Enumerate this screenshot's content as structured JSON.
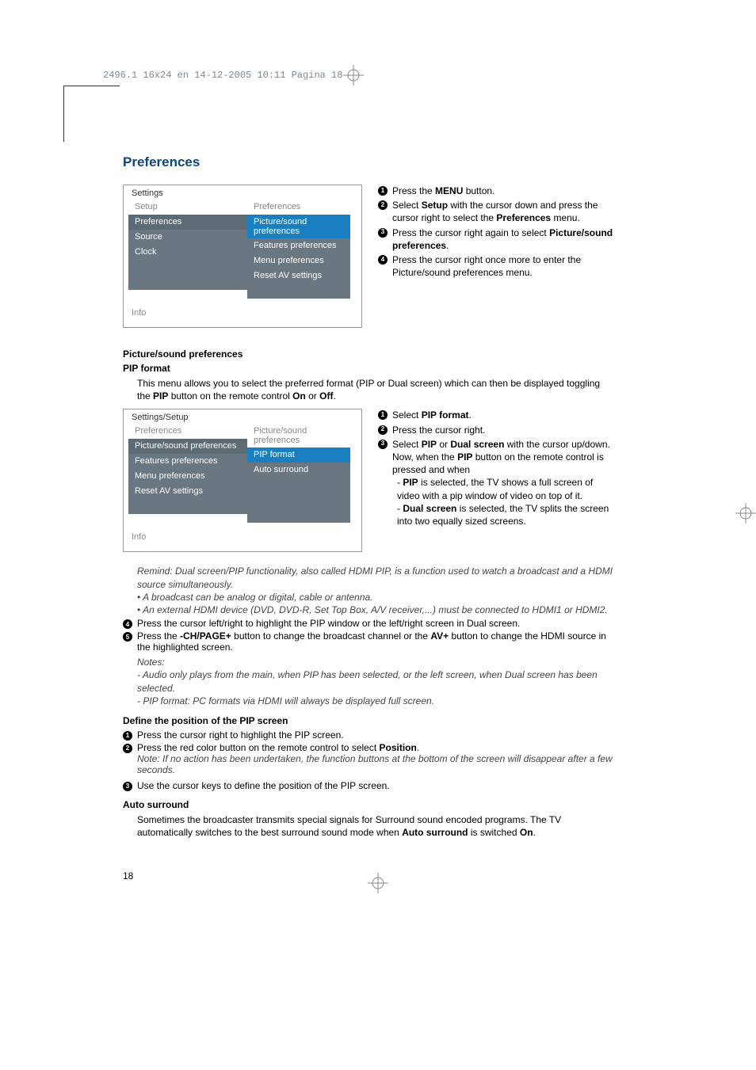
{
  "header_line": "2496.1 16x24 en  14-12-2005  10:11  Pagina 18",
  "title": "Preferences",
  "menu1": {
    "title": "Settings",
    "colA": [
      "Setup",
      "Preferences",
      "Source",
      "Clock",
      "",
      ""
    ],
    "colB_header": "Preferences",
    "colB": [
      "Picture/sound preferences",
      "Features preferences",
      "Menu preferences",
      "Reset AV settings",
      ""
    ],
    "info": "Info"
  },
  "steps1": {
    "s1": "Press the ",
    "s1b": "MENU",
    "s1c": " button.",
    "s2a": "Select ",
    "s2b": "Setup",
    "s2c": " with the cursor down and press the cursor right to select the ",
    "s2d": "Preferences",
    "s2e": " menu.",
    "s3a": "Press the cursor right again to select ",
    "s3b": "Picture/sound preferences",
    "s3c": ".",
    "s4": "Press the cursor right once more to enter the Picture/sound preferences menu."
  },
  "pic_sound_h": "Picture/sound preferences",
  "pip_format_h": "PIP format",
  "pip_intro_a": "This menu allows you to select the preferred format (PIP or Dual screen) which can then be displayed toggling the ",
  "pip_intro_b": "PIP",
  "pip_intro_c": " button on the remote control ",
  "pip_intro_d": "On",
  "pip_intro_e": " or ",
  "pip_intro_f": "Off",
  "pip_intro_g": ".",
  "menu2": {
    "title": "Settings/Setup",
    "colA_header": "Preferences",
    "colA": [
      "Picture/sound preferences",
      "Features preferences",
      "Menu preferences",
      "Reset AV settings",
      ""
    ],
    "colB_header": "Picture/sound preferences",
    "colB": [
      "PIP format",
      "Auto surround",
      "",
      "",
      ""
    ],
    "info": "Info"
  },
  "steps2": {
    "s1a": "Select ",
    "s1b": "PIP format",
    "s1c": ".",
    "s2": "Press the cursor right.",
    "s3a": "Select ",
    "s3b": "PIP",
    "s3c": " or ",
    "s3d": "Dual screen",
    "s3e": " with the cursor up/down. Now, when the ",
    "s3f": "PIP",
    "s3g": " button on the remote control is pressed and when",
    "sub1a": "- ",
    "sub1b": "PIP",
    "sub1c": " is selected, the TV shows a full screen of video with a pip window of video on top of it.",
    "sub2a": "- ",
    "sub2b": "Dual screen",
    "sub2c": " is selected, the TV splits the screen into two equally sized screens."
  },
  "remind": "Remind: Dual screen/PIP functionality, also called HDMI PIP, is a function used to watch a broadcast and a HDMI source simultaneously.",
  "remind_b1": "• A broadcast can be analog or digital, cable or antenna.",
  "remind_b2": "• An external HDMI device (DVD, DVD-R, Set Top Box, A/V receiver,...) must be  connected to HDMI1 or HDMI2.",
  "s4": "Press the cursor left/right to highlight the PIP window or the left/right screen in Dual screen.",
  "s5a": "Press the ",
  "s5b": "-CH/PAGE+",
  "s5c": " button to change the broadcast channel or the ",
  "s5d": "AV+",
  "s5e": " button to change the HDMI source in the highlighted screen.",
  "notes_h": "Notes:",
  "note1": "- Audio only plays from the main, when PIP has been selected, or the left screen, when Dual screen has been selected.",
  "note2": "- PIP format: PC formats via HDMI will always be displayed full screen.",
  "define_pos_h": "Define the position of the PIP screen",
  "dp1": "Press the cursor right to highlight the PIP screen.",
  "dp2a": "Press the red color button on the remote control to select ",
  "dp2b": "Position",
  "dp2c": ".",
  "dp2note": "Note: If no action has been undertaken, the function buttons at the bottom of the screen will disappear after a few seconds.",
  "dp3": "Use the cursor keys to define the position of the PIP screen.",
  "auto_h": "Auto surround",
  "auto_text_a": "Sometimes the broadcaster transmits special signals for Surround sound encoded programs. The TV automatically switches to the best surround sound mode when ",
  "auto_text_b": "Auto surround",
  "auto_text_c": " is switched ",
  "auto_text_d": "On",
  "auto_text_e": ".",
  "page_num": "18"
}
